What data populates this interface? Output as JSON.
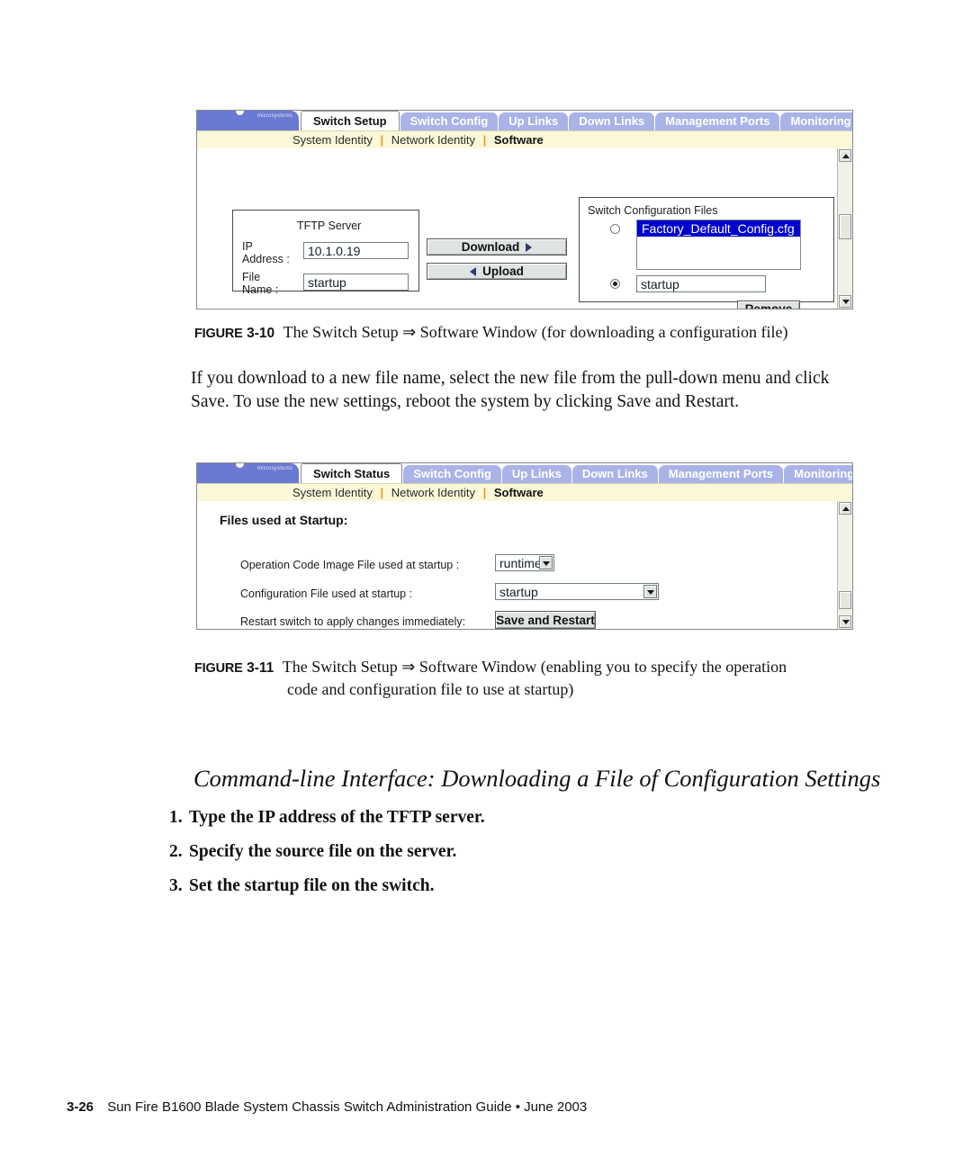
{
  "page": {
    "footer": {
      "page_number": "3-26",
      "text": "Sun Fire B1600 Blade System Chassis Switch Administration Guide • June 2003"
    }
  },
  "figure_10": {
    "label": "FIGURE",
    "number": "3-10",
    "caption": "The Switch Setup ⇒ Software Window (for downloading a configuration file)",
    "screenshot": {
      "logo_word": "microsystems",
      "tabs": [
        {
          "label": "Switch Setup",
          "active": true
        },
        {
          "label": "Switch Config",
          "active": false
        },
        {
          "label": "Up Links",
          "active": false
        },
        {
          "label": "Down Links",
          "active": false
        },
        {
          "label": "Management Ports",
          "active": false
        },
        {
          "label": "Monitoring",
          "active": false
        }
      ],
      "subnav": [
        {
          "label": "System Identity",
          "active": false
        },
        {
          "label": "Network Identity",
          "active": false
        },
        {
          "label": "Software",
          "active": true
        }
      ],
      "tftp_group": {
        "title": "TFTP Server",
        "ip_label_line1": "IP",
        "ip_label_line2": "Address :",
        "ip_value": "10.1.0.19",
        "file_label_line1": "File",
        "file_label_line2": "Name  :",
        "file_value": "startup"
      },
      "actions": {
        "download_label": "Download",
        "upload_label": "Upload"
      },
      "config_group": {
        "title": "Switch Configuration Files",
        "listbox_options": [
          {
            "label": "Factory_Default_Config.cfg",
            "selected": true
          }
        ],
        "radio_list_checked": false,
        "radio_text_checked": true,
        "text_value": "startup",
        "remove_label": "Remove"
      }
    }
  },
  "paragraph": {
    "text": "If you download to a new file name, select the new file from the pull-down menu and click Save. To use the new settings, reboot the system by clicking Save and Restart."
  },
  "figure_11": {
    "label": "FIGURE",
    "number": "3-11",
    "caption_line1": "The Switch Setup ⇒ Software Window (enabling you to specify the operation",
    "caption_line2": "code and configuration file to use at startup)",
    "screenshot": {
      "logo_word": "microsystems",
      "tabs": [
        {
          "label": "Switch Status",
          "active": true
        },
        {
          "label": "Switch Config",
          "active": false
        },
        {
          "label": "Up Links",
          "active": false
        },
        {
          "label": "Down Links",
          "active": false
        },
        {
          "label": "Management Ports",
          "active": false
        },
        {
          "label": "Monitoring",
          "active": false
        }
      ],
      "subnav": [
        {
          "label": "System Identity",
          "active": false
        },
        {
          "label": "Network Identity",
          "active": false
        },
        {
          "label": "Software",
          "active": true
        }
      ],
      "heading": "Files used at Startup:",
      "rows": [
        {
          "label": "Operation Code Image File used at startup :",
          "control": "select",
          "value": "runtime"
        },
        {
          "label": "Configuration File used at startup :",
          "control": "select",
          "value": "startup"
        },
        {
          "label": "Restart switch to apply changes immediately:",
          "control": "button",
          "value": "Save and Restart"
        }
      ]
    }
  },
  "section": {
    "heading": "Command-line Interface: Downloading a File of Configuration Settings",
    "steps": [
      {
        "index": "1.",
        "text": "Type the IP address of the TFTP server."
      },
      {
        "index": "2.",
        "text": "Specify the source file on the server."
      },
      {
        "index": "3.",
        "text": "Set the startup file on the switch."
      }
    ]
  }
}
